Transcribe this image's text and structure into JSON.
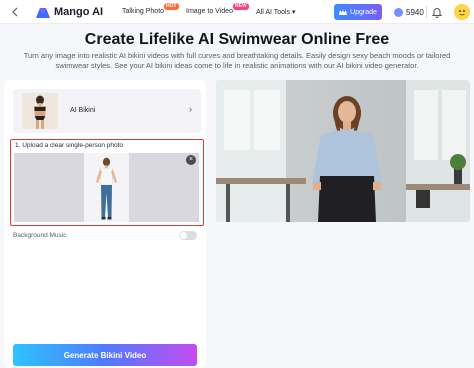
{
  "header": {
    "back_icon": "chevron-left-icon",
    "logo_text": "Mango AI",
    "nav": {
      "talking_photo": "Talking Photo",
      "talking_photo_badge": "HOT",
      "image_to_video": "Image to Video",
      "image_to_video_badge": "NEW",
      "all_ai_tools": "All AI Tools ▾"
    },
    "upgrade_label": "Upgrade",
    "credits": "5940"
  },
  "page": {
    "title": "Create Lifelike AI Swimwear Online Free",
    "description": "Turn any image into realistic AI bikini videos with full curves and breathtaking details. Easily design sexy beach moods or tailored swimwear styles. See your AI bikini ideas come to life in realistic animations with our AI bikini video generator."
  },
  "left_panel": {
    "template_label": "AI Bikini",
    "upload_label": "1. Upload a clear single-person photo",
    "music_label": "Background Music",
    "music_enabled": false,
    "generate_label": "Generate Bikini Video"
  },
  "colors": {
    "accent_blue": "#4f7bff",
    "upload_border": "#e53935",
    "gradient_start": "#2fc3ff",
    "gradient_end": "#c44bf0"
  }
}
